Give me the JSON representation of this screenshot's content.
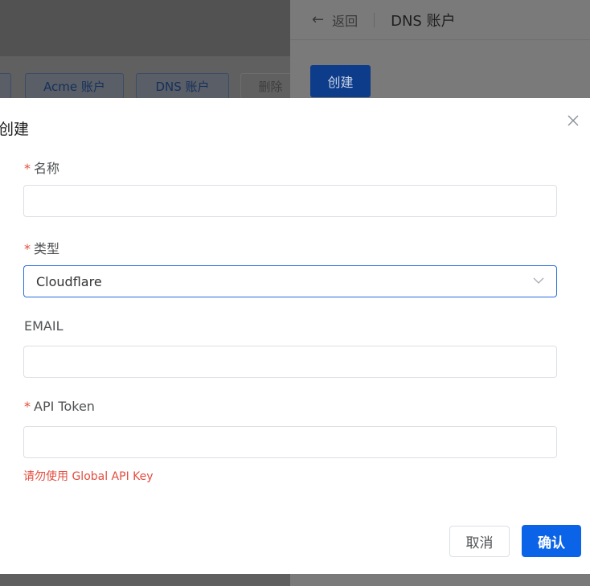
{
  "background": {
    "toolbar": {
      "acme_label": "Acme 账户",
      "dns_label": "DNS 账户",
      "delete_label": "删除"
    }
  },
  "drawer": {
    "back_label": "返回",
    "title": "DNS 账户",
    "create_label": "创建"
  },
  "modal": {
    "title": "创建",
    "fields": {
      "name": {
        "label": "名称",
        "required": true,
        "value": ""
      },
      "type": {
        "label": "类型",
        "required": true,
        "value": "Cloudflare"
      },
      "email": {
        "label": "EMAIL",
        "required": false,
        "value": ""
      },
      "api_token": {
        "label": "API Token",
        "required": true,
        "value": ""
      }
    },
    "hint": "请勿使用 Global API Key",
    "cancel_label": "取消",
    "confirm_label": "确认"
  },
  "colors": {
    "primary": "#0b63e8",
    "required_mark": "#e34d3f",
    "border": "#dcdfe6",
    "focus_border": "#2a6de0"
  },
  "icons": {
    "close": "close-icon",
    "back": "arrow-left-icon",
    "select": "chevron-down-icon"
  }
}
